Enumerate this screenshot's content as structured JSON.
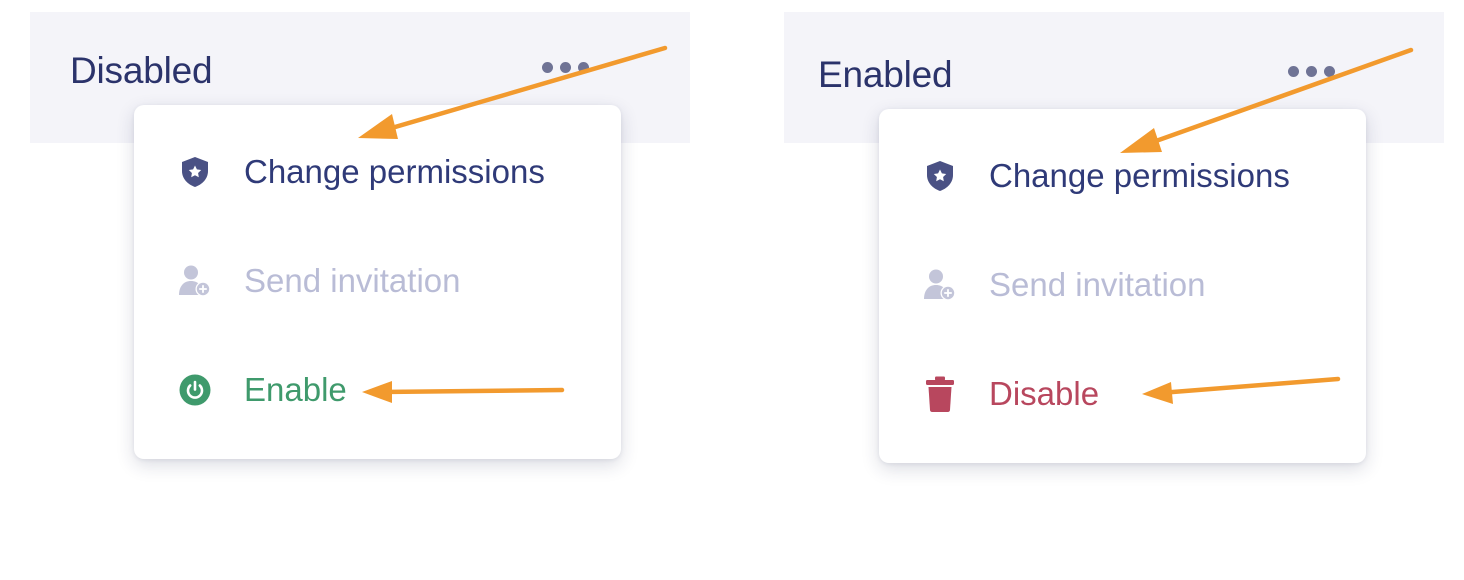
{
  "panels": [
    {
      "status": "Disabled",
      "menu": {
        "change_permissions": "Change permissions",
        "send_invitation": "Send invitation",
        "toggle_action": "Enable"
      }
    },
    {
      "status": "Enabled",
      "menu": {
        "change_permissions": "Change permissions",
        "send_invitation": "Send invitation",
        "toggle_action": "Disable"
      }
    }
  ],
  "icons": {
    "more": "more-horizontal-icon",
    "permissions": "shield-star-icon",
    "invite": "user-add-icon",
    "enable": "power-icon",
    "disable": "trash-icon"
  },
  "colors": {
    "header_background": "#f4f4f9",
    "primary_text": "#2b336b",
    "menu_text": "#2f3a78",
    "disabled_text": "#b9bcd6",
    "enable_green": "#3f9a6c",
    "disable_red": "#b8475e",
    "annotation_arrow": "#f29a2e"
  }
}
